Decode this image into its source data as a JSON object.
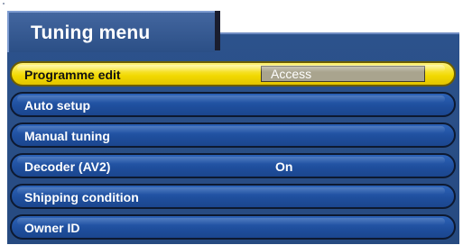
{
  "menu": {
    "title": "Tuning menu",
    "items": [
      {
        "label": "Programme edit",
        "value": "Access",
        "selected": true
      },
      {
        "label": "Auto setup",
        "value": ""
      },
      {
        "label": "Manual tuning",
        "value": ""
      },
      {
        "label": "Decoder (AV2)",
        "value": "On"
      },
      {
        "label": "Shipping condition",
        "value": ""
      },
      {
        "label": "Owner ID",
        "value": ""
      }
    ]
  },
  "colors": {
    "panel": "#2a4f88",
    "item": "#1f4f9e",
    "selected": "#f1d800",
    "access_box": "#a9a48e"
  }
}
